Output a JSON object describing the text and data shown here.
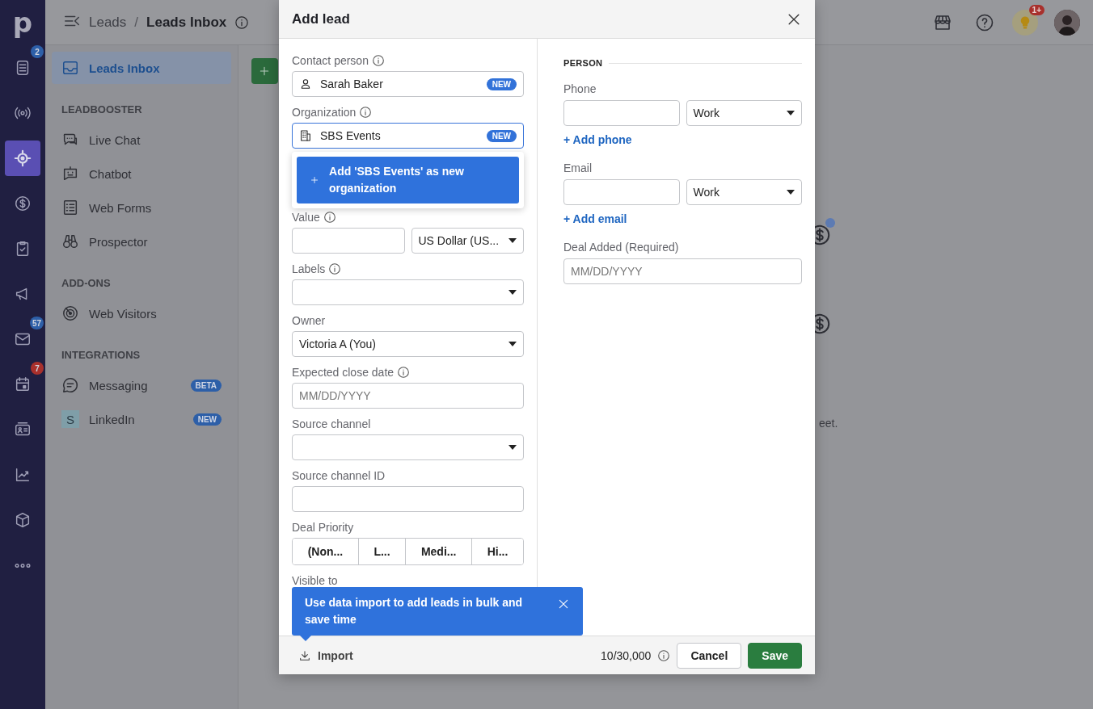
{
  "rail": {
    "logo": "p",
    "items": [
      {
        "selected": false,
        "badge": {
          "text": "2",
          "color": "#2d5fa8"
        }
      },
      {
        "selected": false
      },
      {
        "selected": true
      },
      {
        "selected": false
      },
      {
        "selected": false
      },
      {
        "selected": false
      },
      {
        "selected": false,
        "badge": {
          "text": "57",
          "color": "#2d5fa8"
        }
      },
      {
        "selected": false,
        "badge": {
          "text": "7",
          "color": "#a8302c"
        }
      },
      {
        "selected": false
      },
      {
        "selected": false
      },
      {
        "selected": false
      },
      {
        "selected": false
      }
    ]
  },
  "breadcrumb": [
    "Leads",
    "Leads Inbox"
  ],
  "breadcrumb_separator": "/",
  "top_bar": {
    "notification_badge": "1+"
  },
  "sidebar": {
    "groups": [
      {
        "items": [
          {
            "label": "Leads Inbox",
            "selected": true
          }
        ]
      },
      {
        "title": "LEADBOOSTER",
        "items": [
          {
            "label": "Live Chat",
            "selected": false
          },
          {
            "label": "Chatbot",
            "selected": false
          },
          {
            "label": "Web Forms",
            "selected": false
          },
          {
            "label": "Prospector",
            "selected": false
          }
        ]
      },
      {
        "title": "ADD-ONS",
        "items": [
          {
            "label": "Web Visitors",
            "selected": false
          }
        ]
      },
      {
        "title": "INTEGRATIONS",
        "items": [
          {
            "label": "Messaging",
            "selected": false,
            "badge": "BETA"
          },
          {
            "label": "LinkedIn",
            "selected": false,
            "badge": "NEW",
            "icon_text": "S"
          }
        ]
      }
    ]
  },
  "main": {
    "empty_state_text": "eet."
  },
  "modal": {
    "title": "Add lead",
    "left_fields": [
      {
        "kind": "entity",
        "label": "Contact person",
        "info": true,
        "value": "Sarah Baker",
        "badge": "NEW",
        "focused": false
      },
      {
        "kind": "entity",
        "label": "Organization",
        "info": true,
        "value": "SBS Events",
        "badge": "NEW",
        "focused": true,
        "suggestion": "Add 'SBS Events' as new organization"
      },
      {
        "kind": "money",
        "label": "Value",
        "info": true,
        "currency": "US Dollar (US..."
      },
      {
        "kind": "select",
        "label": "Labels",
        "info": true
      },
      {
        "kind": "select",
        "label": "Owner",
        "info": false,
        "value": "Victoria A (You)"
      },
      {
        "kind": "input",
        "label": "Expected close date",
        "info": true,
        "placeholder": "MM/DD/YYYY"
      },
      {
        "kind": "select",
        "label": "Source channel",
        "info": false
      },
      {
        "kind": "input",
        "label": "Source channel ID",
        "info": false
      },
      {
        "kind": "segments",
        "label": "Deal Priority",
        "info": false,
        "options": [
          {
            "label": "(Non...",
            "selected": false
          },
          {
            "label": "L...",
            "selected": false
          },
          {
            "label": "Medi...",
            "selected": false
          },
          {
            "label": "Hi...",
            "selected": false
          }
        ]
      },
      {
        "kind": "label",
        "label": "Visible to",
        "info": false
      }
    ],
    "right_section": "PERSON",
    "right_fields": [
      {
        "kind": "typed",
        "label": "Phone",
        "type": "Work",
        "link": "+ Add phone"
      },
      {
        "kind": "typed",
        "label": "Email",
        "type": "Work",
        "link": "+ Add email"
      },
      {
        "kind": "input",
        "label": "Deal Added (Required)",
        "placeholder": "MM/DD/YYYY"
      }
    ],
    "tooltip": "Use data import to add leads in bulk and save time",
    "footer": {
      "import": "Import",
      "counter": "10/30,000",
      "buttons": [
        {
          "label": "Cancel",
          "kind": "secondary"
        },
        {
          "label": "Save",
          "kind": "primary"
        }
      ]
    }
  }
}
